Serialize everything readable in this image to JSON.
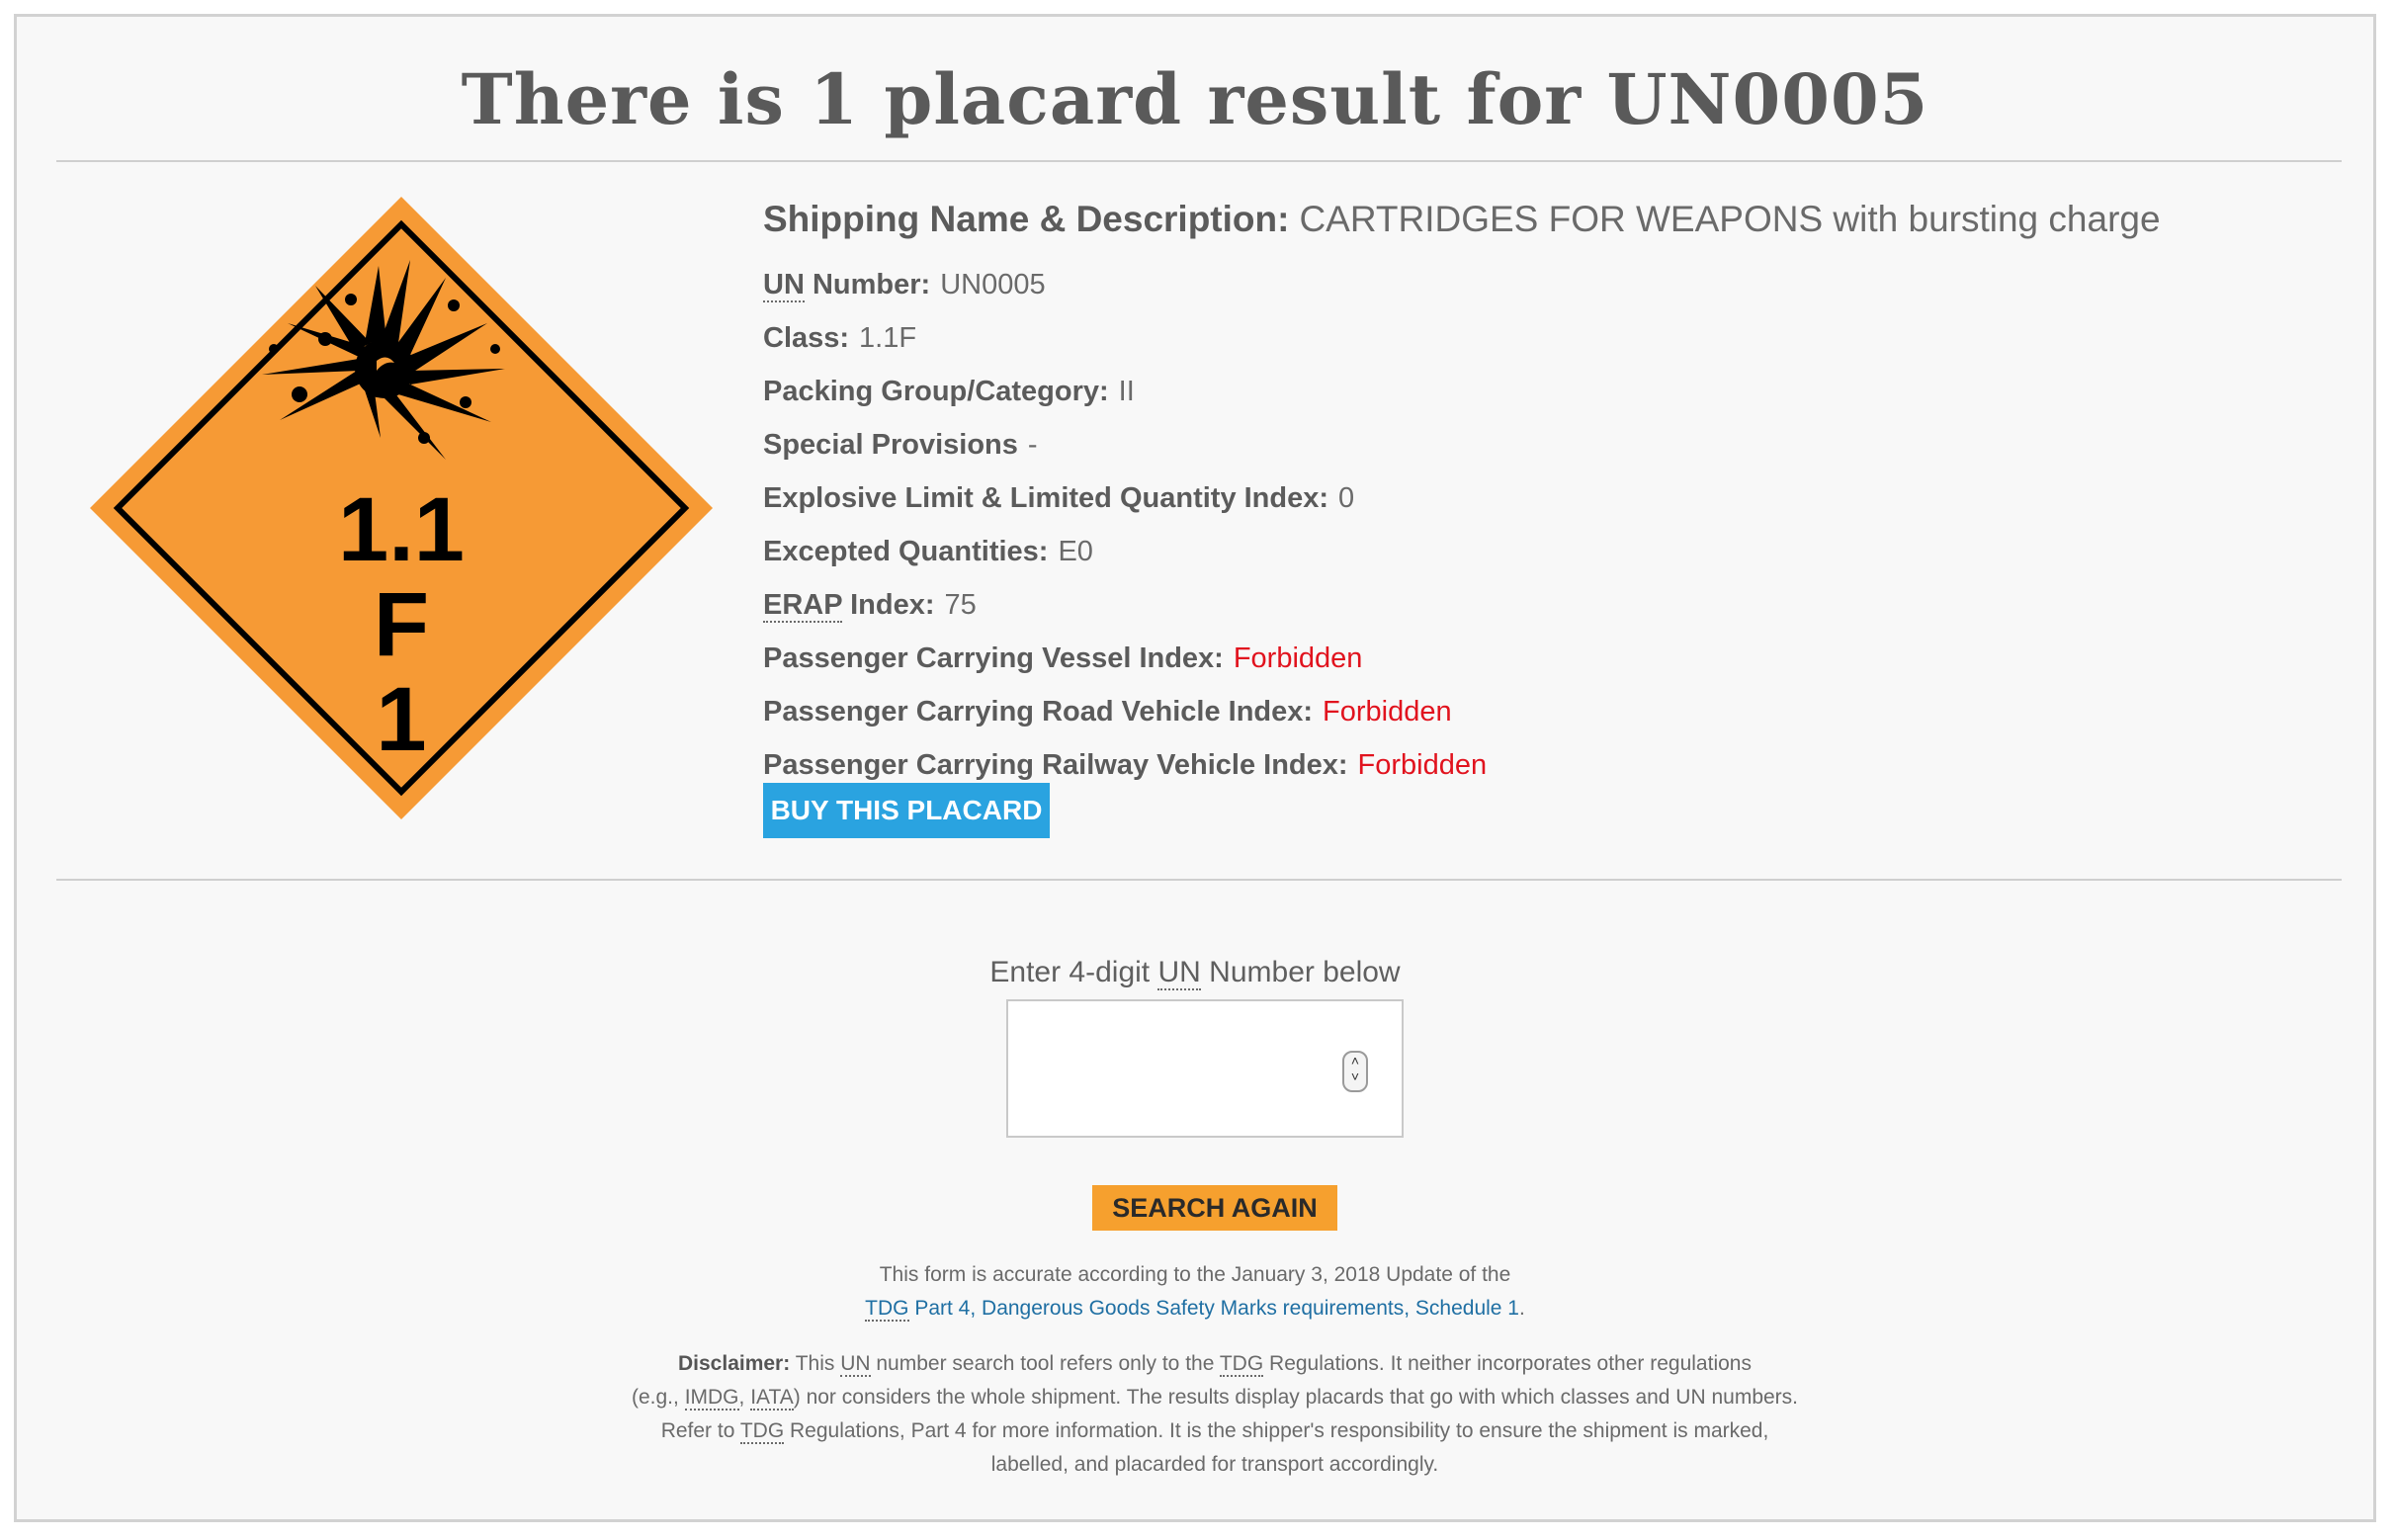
{
  "page": {
    "title": "There is 1 placard result for UN0005"
  },
  "placard": {
    "icon": "explosive-bomb-icon",
    "line1": "1.1",
    "line2": "F",
    "line3": "1",
    "colors": {
      "fill": "#f69a35",
      "border": "#000000"
    }
  },
  "details": {
    "shipping_name_label": "Shipping Name & Description:",
    "shipping_name_value": "CARTRIDGES FOR WEAPONS with bursting charge",
    "un_abbr": "UN",
    "un_label_rest": " Number:",
    "un_value": "UN0005",
    "class_label": "Class:",
    "class_value": "1.1F",
    "packing_label": "Packing Group/Category:",
    "packing_value": "II",
    "special_label": "Special Provisions",
    "special_value": "-",
    "explosive_label": "Explosive Limit & Limited Quantity Index:",
    "explosive_value": "0",
    "excepted_label": "Excepted Quantities:",
    "excepted_value": "E0",
    "erap_abbr": "ERAP",
    "erap_label_rest": " Index:",
    "erap_value": "75",
    "vessel_label": "Passenger Carrying Vessel Index:",
    "vessel_value": "Forbidden",
    "road_label": "Passenger Carrying Road Vehicle Index:",
    "road_value": "Forbidden",
    "rail_label": "Passenger Carrying Railway Vehicle Index:",
    "rail_value": "Forbidden",
    "forbidden_color": "#e1131e"
  },
  "buy_button": "BUY THIS PLACARD",
  "search": {
    "label_pre": "Enter 4-digit ",
    "label_abbr": "UN",
    "label_post": " Number below",
    "value": "",
    "button": "SEARCH AGAIN"
  },
  "note": {
    "line1": "This form is accurate according to the January 3, 2018 Update of the",
    "link_abbr": "TDG",
    "link_rest": " Part 4, Dangerous Goods Safety Marks requirements, Schedule 1",
    "link_end": "."
  },
  "disclaimer": {
    "label": "Disclaimer:",
    "t1": " This ",
    "a1": "UN",
    "t2": " number search tool refers only to the ",
    "a2": "TDG",
    "t3": " Regulations. It neither incorporates other regulations",
    "t4": "(e.g., ",
    "a3": "IMDG",
    "t5": ", ",
    "a4": "IATA",
    "t6": ") nor considers the whole shipment. The results display placards that go with which classes and UN numbers.",
    "t7": "Refer to ",
    "a5": "TDG",
    "t8": " Regulations, Part 4 for more information. It is the shipper's responsibility to ensure the shipment is marked,",
    "t9": "labelled, and placarded for transport accordingly."
  }
}
